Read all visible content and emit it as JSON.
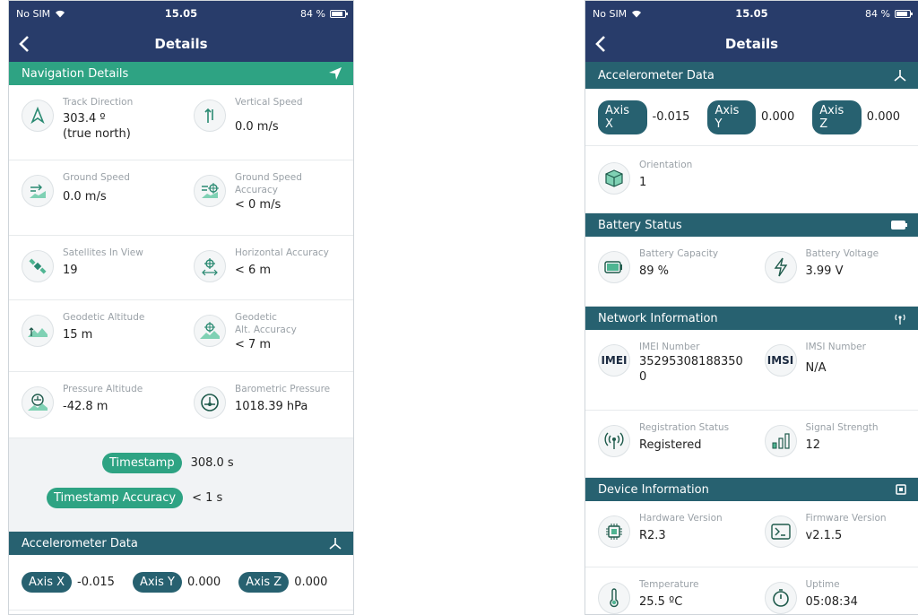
{
  "status": {
    "carrier": "No SIM",
    "time": "15.05",
    "battery_pct": "84 %",
    "battery_level": 0.84
  },
  "title": "Details",
  "colors": {
    "nav": "#283c6a",
    "green": "#2ea383",
    "teal": "#276170"
  },
  "left": {
    "navigation": {
      "header": "Navigation Details",
      "header_icon": "location-arrow-icon",
      "rows": [
        [
          {
            "icon": "track-direction-icon",
            "label": "Track Direction",
            "value": "303.4 º",
            "value2": "(true north)"
          },
          {
            "icon": "vertical-speed-icon",
            "label": "Vertical Speed",
            "value": "0.0 m/s"
          }
        ],
        [
          {
            "icon": "ground-speed-icon",
            "label": "Ground Speed",
            "value": "0.0 m/s"
          },
          {
            "icon": "ground-speed-accuracy-icon",
            "label": "Ground Speed",
            "label2": "Accuracy",
            "value": "< 0 m/s"
          }
        ],
        [
          {
            "icon": "satellite-icon",
            "label": "Satellites In View",
            "value": "19"
          },
          {
            "icon": "horizontal-accuracy-icon",
            "label": "Horizontal Accuracy",
            "value": "< 6 m"
          }
        ],
        [
          {
            "icon": "geodetic-altitude-icon",
            "label": "Geodetic Altitude",
            "value": "15 m"
          },
          {
            "icon": "geodetic-accuracy-icon",
            "label": "Geodetic",
            "label2": "Alt. Accuracy",
            "value": "< 7 m"
          }
        ],
        [
          {
            "icon": "pressure-altitude-icon",
            "label": "Pressure Altitude",
            "value": "-42.8 m"
          },
          {
            "icon": "barometer-icon",
            "label": "Barometric Pressure",
            "value": "1018.39 hPa"
          }
        ]
      ]
    },
    "timestamp": {
      "label": "Timestamp",
      "value": "308.0 s",
      "accuracy_label": "Timestamp Accuracy",
      "accuracy_value": "< 1 s"
    },
    "accelerometer": {
      "header": "Accelerometer Data",
      "header_icon": "axes-icon",
      "x_label": "Axis X",
      "x": "-0.015",
      "y_label": "Axis Y",
      "y": "0.000",
      "z_label": "Axis Z",
      "z": "0.000"
    }
  },
  "right": {
    "accelerometer": {
      "header": "Accelerometer Data",
      "header_icon": "axes-icon",
      "x_label": "Axis X",
      "x": "-0.015",
      "y_label": "Axis Y",
      "y": "0.000",
      "z_label": "Axis Z",
      "z": "0.000",
      "orientation_label": "Orientation",
      "orientation": "1"
    },
    "battery": {
      "header": "Battery Status",
      "header_icon": "battery-icon",
      "capacity_label": "Battery Capacity",
      "capacity": "89 %",
      "voltage_label": "Battery Voltage",
      "voltage": "3.99 V"
    },
    "network": {
      "header": "Network Information",
      "header_icon": "antenna-icon",
      "imei_label": "IMEI Number",
      "imei": "35295308188350",
      "imei2": "0",
      "imei_icon": "IMEI",
      "imsi_label": "IMSI Number",
      "imsi": "N/A",
      "imsi_icon": "IMSI",
      "reg_label": "Registration Status",
      "reg": "Registered",
      "signal_label": "Signal Strength",
      "signal": "12"
    },
    "device": {
      "header": "Device Information",
      "header_icon": "chip-icon",
      "hw_label": "Hardware Version",
      "hw": "R2.3",
      "fw_label": "Firmware Version",
      "fw": "v2.1.5",
      "temp_label": "Temperature",
      "temp": "25.5 ºC",
      "uptime_label": "Uptime",
      "uptime": "05:08:34"
    }
  }
}
